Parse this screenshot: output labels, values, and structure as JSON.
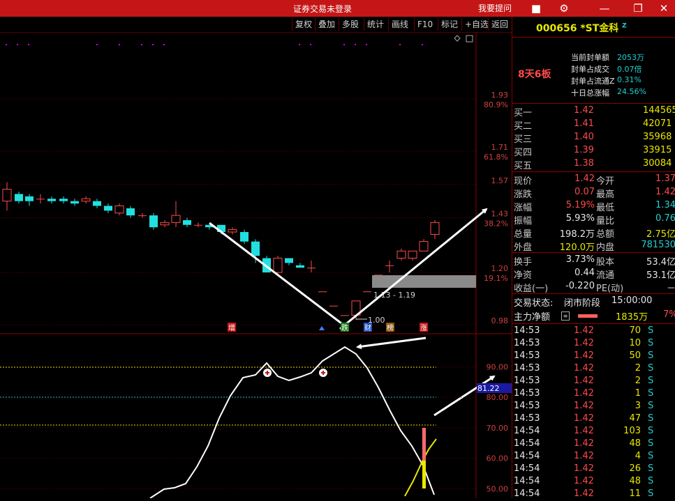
{
  "titlebar": {
    "title": "证券交易未登录",
    "ask": "我要提问",
    "icons": [
      "box-icon",
      "gear-icon",
      "minimize-icon",
      "restore-icon",
      "close-icon"
    ]
  },
  "toolbar": {
    "buttons": [
      "复权",
      "叠加",
      "多股",
      "统计",
      "画线",
      "F10",
      "标记",
      "+自选",
      "返回"
    ]
  },
  "chart": {
    "price_ticks": [
      "1.93",
      "1.71",
      "1.57",
      "1.43",
      "1.20",
      "0.98"
    ],
    "pct_ticks": [
      "80.9%",
      "61.8%",
      "38.2%",
      "19.1%"
    ],
    "range_label": "1.13 - 1.19",
    "low_label": "1.00",
    "event_labels": [
      "增",
      "跌",
      "财",
      "榜",
      "涨"
    ],
    "indicator_ticks": [
      "90.00",
      "80.00",
      "70.00",
      "60.00",
      "50.00"
    ],
    "indicator_current": "81.22"
  },
  "stock": {
    "code": "000656",
    "name": "*ST金科",
    "badge": "Z",
    "board": "8天6板",
    "stats": [
      {
        "label": "当前封单额",
        "value": "2053万"
      },
      {
        "label": "封单占成交",
        "value": "0.07倍"
      },
      {
        "label": "封单占流通Z",
        "value": "0.31%"
      },
      {
        "label": "十日总涨幅",
        "value": "24.56%"
      }
    ],
    "bids": [
      {
        "label": "买一",
        "price": "1.42",
        "vol": "144565"
      },
      {
        "label": "买二",
        "price": "1.41",
        "vol": "42071"
      },
      {
        "label": "买三",
        "price": "1.40",
        "vol": "35968"
      },
      {
        "label": "买四",
        "price": "1.39",
        "vol": "33915"
      },
      {
        "label": "买五",
        "price": "1.38",
        "vol": "30084"
      }
    ],
    "quotes": [
      {
        "l1": "现价",
        "v1": "1.42",
        "l2": "今开",
        "v2": "1.37"
      },
      {
        "l1": "涨跌",
        "v1": "0.07",
        "l2": "最高",
        "v2": "1.42"
      },
      {
        "l1": "涨幅",
        "v1": "5.19%",
        "l2": "最低",
        "v2": "1.34"
      },
      {
        "l1": "振幅",
        "v1": "5.93%",
        "l2": "量比",
        "v2": "0.76"
      },
      {
        "l1": "总量",
        "v1": "198.2万",
        "l2": "总额",
        "v2": "2.75亿"
      },
      {
        "l1": "外盘",
        "v1": "120.0万",
        "l2": "内盘",
        "v2": "781530"
      }
    ],
    "quotes2": [
      {
        "l1": "换手",
        "v1": "3.73%",
        "l2": "股本",
        "v2": "53.4亿"
      },
      {
        "l1": "净资",
        "v1": "0.44",
        "l2": "流通",
        "v2": "53.1亿"
      },
      {
        "l1": "收益(一)",
        "v1": "-0.220",
        "l2": "PE(动)",
        "v2": "－"
      }
    ],
    "status_label": "交易状态:",
    "status_value": "闭市阶段",
    "status_time": "15:00:00",
    "mainflow_label": "主力净额",
    "mainflow_value": "1835万",
    "mainflow_pct": "7%"
  },
  "ticks": [
    {
      "t": "14:53",
      "p": "1.42",
      "v": "70",
      "s": "S"
    },
    {
      "t": "14:53",
      "p": "1.42",
      "v": "10",
      "s": "S"
    },
    {
      "t": "14:53",
      "p": "1.42",
      "v": "50",
      "s": "S"
    },
    {
      "t": "14:53",
      "p": "1.42",
      "v": "2",
      "s": "S"
    },
    {
      "t": "14:53",
      "p": "1.42",
      "v": "2",
      "s": "S"
    },
    {
      "t": "14:53",
      "p": "1.42",
      "v": "1",
      "s": "S"
    },
    {
      "t": "14:53",
      "p": "1.42",
      "v": "3",
      "s": "S"
    },
    {
      "t": "14:53",
      "p": "1.42",
      "v": "47",
      "s": "S"
    },
    {
      "t": "14:54",
      "p": "1.42",
      "v": "103",
      "s": "S"
    },
    {
      "t": "14:54",
      "p": "1.42",
      "v": "48",
      "s": "S"
    },
    {
      "t": "14:54",
      "p": "1.42",
      "v": "4",
      "s": "S"
    },
    {
      "t": "14:54",
      "p": "1.42",
      "v": "26",
      "s": "S"
    },
    {
      "t": "14:54",
      "p": "1.42",
      "v": "48",
      "s": "S"
    },
    {
      "t": "14:54",
      "p": "1.42",
      "v": "11",
      "s": "S"
    }
  ],
  "colors": {
    "up": "#ff4a4a",
    "down": "#22e0e0",
    "titlebar": "#c41616",
    "grid": "#8a0000"
  }
}
